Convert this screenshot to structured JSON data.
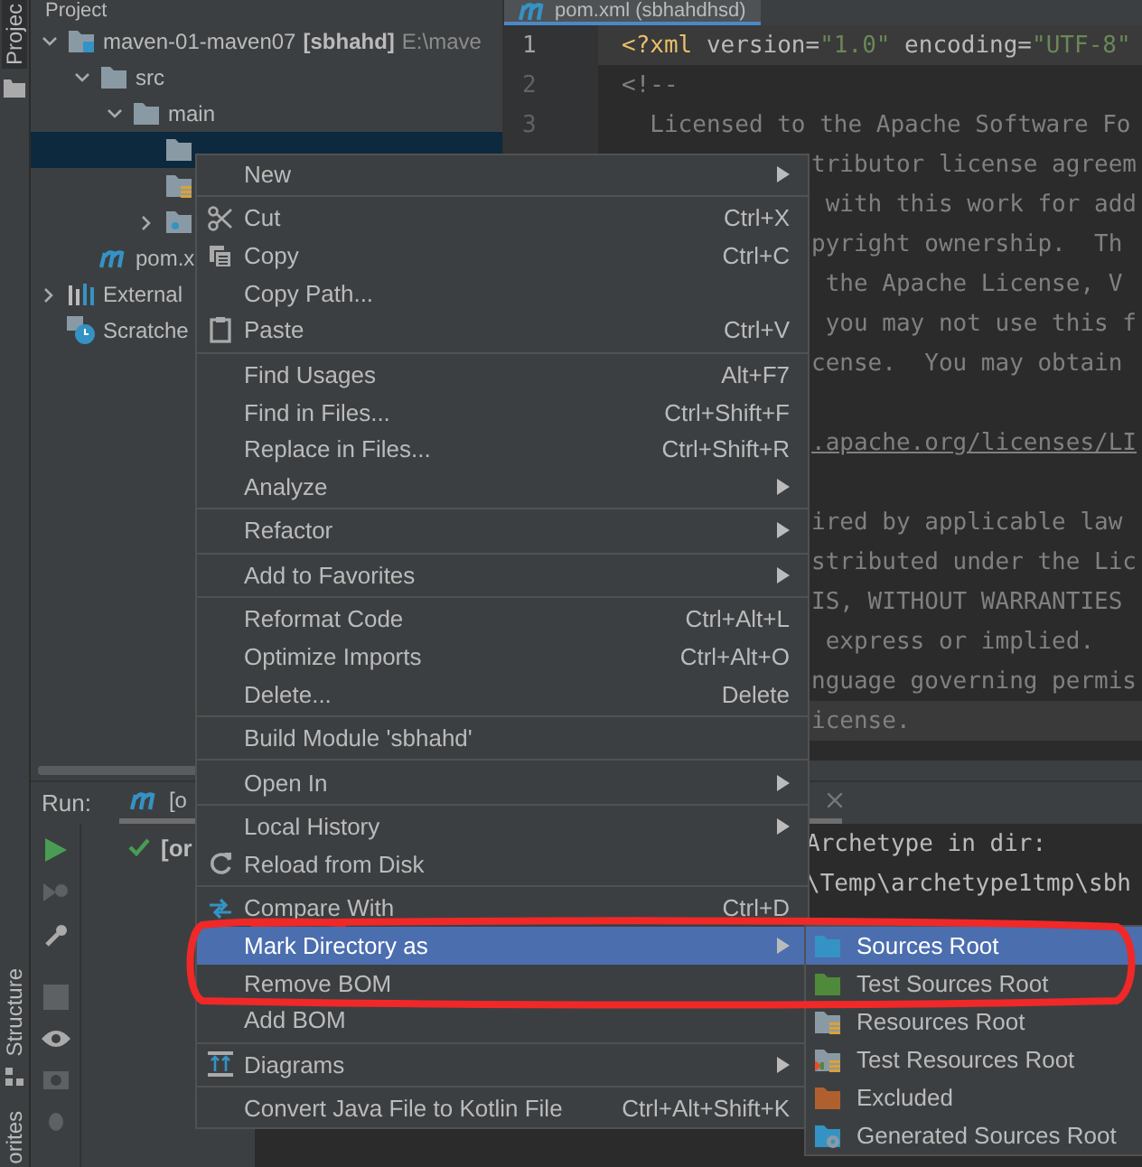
{
  "left_strip": {
    "tabs": [
      {
        "label": "Projec",
        "selected": true
      },
      {
        "label": "Structure",
        "selected": false
      },
      {
        "label": "orites",
        "selected": false
      }
    ]
  },
  "project_panel": {
    "title": "Project",
    "tree": [
      {
        "kind": "module",
        "label": "maven-01-maven07",
        "module": "[sbhahd]",
        "path": "E:\\mave",
        "expanded": true,
        "selected": false,
        "children": [
          {
            "kind": "folder",
            "label": "src",
            "expanded": true,
            "selected": false,
            "children": [
              {
                "kind": "folder",
                "label": "main",
                "expanded": true,
                "selected": false,
                "children": [
                  {
                    "kind": "folder",
                    "selected": true
                  },
                  {
                    "kind": "resources",
                    "selected": false
                  },
                  {
                    "kind": "package",
                    "expanded": false,
                    "selected": false
                  }
                ]
              }
            ]
          },
          {
            "kind": "maven",
            "label": "pom.x",
            "selected": false
          }
        ]
      },
      {
        "kind": "libraries",
        "label": "External",
        "expanded": false,
        "selected": false
      },
      {
        "kind": "scratches",
        "label": "Scratche",
        "selected": false
      }
    ]
  },
  "editor": {
    "tab": "pom.xml (sbhahdhsd)",
    "lines": [
      {
        "number": "1",
        "current": true,
        "parts": [
          {
            "kind": "tag",
            "text": "<?xml"
          },
          {
            "kind": "attr",
            "text": " version="
          },
          {
            "kind": "value",
            "text": "\"1.0\""
          },
          {
            "kind": "attr",
            "text": " encoding="
          },
          {
            "kind": "value",
            "text": "\"UTF-8\""
          }
        ]
      },
      {
        "number": "2",
        "parts": [
          {
            "kind": "comment",
            "text": "<!--"
          }
        ]
      },
      {
        "number": "3",
        "parts": [
          {
            "kind": "comment",
            "text": "  Licensed to the Apache Software Fo"
          }
        ]
      }
    ],
    "covered": [
      {
        "lines": [
          {
            "parts": [
              {
                "kind": "comment",
                "text": "tributor license agreem"
              }
            ]
          },
          {
            "parts": [
              {
                "kind": "comment",
                "text": " with this work for add"
              }
            ]
          },
          {
            "parts": [
              {
                "kind": "comment",
                "text": "pyright ownership.  Th"
              }
            ]
          },
          {
            "parts": [
              {
                "kind": "comment",
                "text": " the Apache License, V"
              }
            ]
          },
          {
            "parts": [
              {
                "kind": "comment",
                "text": " you may not use this f"
              }
            ]
          },
          {
            "parts": [
              {
                "kind": "comment",
                "text": "cense.  You may obtain"
              }
            ]
          }
        ]
      },
      {
        "lines": [
          {
            "parts": [
              {
                "kind": "link",
                "text": ".apache.org/licenses/LI"
              }
            ]
          }
        ]
      },
      {
        "lines": [
          {
            "parts": [
              {
                "kind": "comment",
                "text": "ired by applicable law"
              }
            ]
          },
          {
            "parts": [
              {
                "kind": "comment",
                "text": "stributed under the Lic"
              }
            ]
          },
          {
            "parts": [
              {
                "kind": "comment",
                "text": "IS, WITHOUT WARRANTIES"
              }
            ]
          },
          {
            "parts": [
              {
                "kind": "comment",
                "text": " express or implied."
              }
            ]
          },
          {
            "parts": [
              {
                "kind": "comment",
                "text": "nguage governing permis"
              }
            ]
          },
          {
            "current": true,
            "parts": [
              {
                "kind": "comment",
                "text": "icense."
              }
            ]
          }
        ]
      }
    ]
  },
  "run_panel": {
    "label": "Run:",
    "tab": "[o",
    "tree_row": "[or",
    "console": [
      "Archetype in dir:",
      "\\Temp\\archetype1tmp\\sbh"
    ]
  },
  "context_menu": {
    "groups": [
      [
        {
          "label": "New",
          "submenu": true,
          "selected": false
        }
      ],
      [
        {
          "label": "Cut",
          "shortcut": "Ctrl+X",
          "submenu": false,
          "selected": false
        },
        {
          "label": "Copy",
          "shortcut": "Ctrl+C",
          "submenu": false,
          "selected": false
        },
        {
          "label": "Copy Path...",
          "submenu": false,
          "selected": false
        },
        {
          "label": "Paste",
          "shortcut": "Ctrl+V",
          "submenu": false,
          "selected": false
        }
      ],
      [
        {
          "label": "Find Usages",
          "shortcut": "Alt+F7",
          "submenu": false,
          "selected": false
        },
        {
          "label": "Find in Files...",
          "shortcut": "Ctrl+Shift+F",
          "submenu": false,
          "selected": false
        },
        {
          "label": "Replace in Files...",
          "shortcut": "Ctrl+Shift+R",
          "submenu": false,
          "selected": false
        },
        {
          "label": "Analyze",
          "submenu": true,
          "selected": false
        }
      ],
      [
        {
          "label": "Refactor",
          "submenu": true,
          "selected": false
        }
      ],
      [
        {
          "label": "Add to Favorites",
          "submenu": true,
          "selected": false
        }
      ],
      [
        {
          "label": "Reformat Code",
          "shortcut": "Ctrl+Alt+L",
          "submenu": false,
          "selected": false
        },
        {
          "label": "Optimize Imports",
          "shortcut": "Ctrl+Alt+O",
          "submenu": false,
          "selected": false
        },
        {
          "label": "Delete...",
          "shortcut": "Delete",
          "submenu": false,
          "selected": false
        }
      ],
      [
        {
          "label": "Build Module 'sbhahd'",
          "submenu": false,
          "selected": false
        }
      ],
      [
        {
          "label": "Open In",
          "submenu": true,
          "selected": false
        }
      ],
      [
        {
          "label": "Local History",
          "submenu": true,
          "selected": false
        },
        {
          "label": "Reload from Disk",
          "submenu": false,
          "selected": false
        }
      ],
      [
        {
          "label": "Compare With",
          "shortcut": "Ctrl+D",
          "submenu": false,
          "selected": false
        },
        {
          "label": "Mark Directory as",
          "submenu": true,
          "selected": true
        },
        {
          "label": "Remove BOM",
          "submenu": false,
          "selected": false
        },
        {
          "label": "Add BOM",
          "submenu": false,
          "selected": false
        }
      ],
      [
        {
          "label": "Diagrams",
          "submenu": true,
          "selected": false
        }
      ],
      [
        {
          "label": "Convert Java File to Kotlin File",
          "shortcut": "Ctrl+Alt+Shift+K",
          "submenu": false,
          "selected": false
        }
      ]
    ]
  },
  "submenu": {
    "items": [
      {
        "label": "Sources Root",
        "selected": true
      },
      {
        "label": "Test Sources Root",
        "selected": false
      },
      {
        "label": "Resources Root",
        "selected": false
      },
      {
        "label": "Test Resources Root",
        "selected": false
      },
      {
        "label": "Excluded",
        "selected": false
      },
      {
        "label": "Generated Sources Root",
        "selected": false
      }
    ]
  }
}
